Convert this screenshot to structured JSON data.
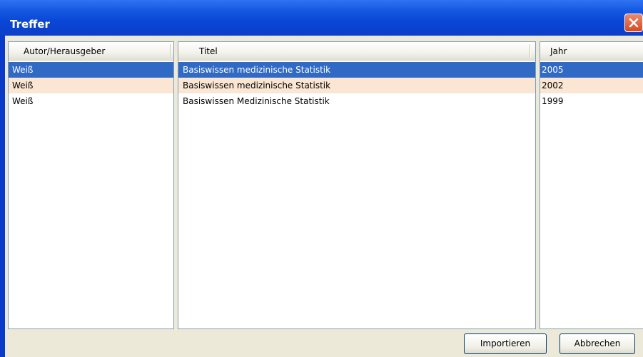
{
  "window": {
    "title": "Treffer"
  },
  "columns": {
    "author": {
      "header": "Autor/Herausgeber"
    },
    "title": {
      "header": "Titel"
    },
    "year": {
      "header": "Jahr"
    }
  },
  "rows": [
    {
      "author": "Weiß",
      "title": "Basiswissen medizinische Statistik",
      "year": "2005",
      "state": "selected"
    },
    {
      "author": "Weiß",
      "title": "Basiswissen medizinische Statistik",
      "year": "2002",
      "state": "alt"
    },
    {
      "author": "Weiß",
      "title": "Basiswissen Medizinische Statistik",
      "year": "1999",
      "state": "normal"
    }
  ],
  "buttons": {
    "import_label": "Importieren",
    "cancel_label": "Abbrechen"
  },
  "colors": {
    "selection": "#316ac5",
    "alt_row": "#fae6d2",
    "titlebar": "#0a46d6",
    "client_bg": "#ece9d8"
  },
  "icons": {
    "close": "close-icon"
  }
}
